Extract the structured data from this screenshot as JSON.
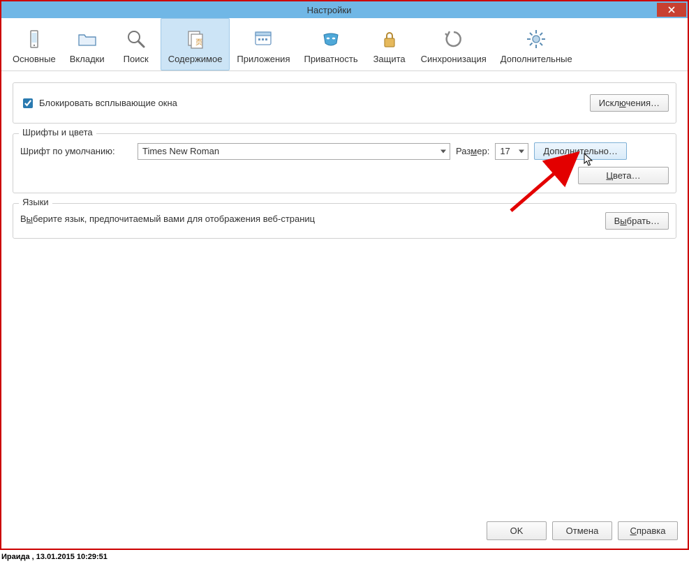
{
  "window": {
    "title": "Настройки"
  },
  "toolbar": {
    "items": [
      {
        "label": "Основные"
      },
      {
        "label": "Вкладки"
      },
      {
        "label": "Поиск"
      },
      {
        "label": "Содержимое"
      },
      {
        "label": "Приложения"
      },
      {
        "label": "Приватность"
      },
      {
        "label": "Защита"
      },
      {
        "label": "Синхронизация"
      },
      {
        "label": "Дополнительные"
      }
    ],
    "activeIndex": 3
  },
  "popup": {
    "checkbox_label": "Блокировать всплывающие окна",
    "checked": true,
    "exceptions_btn": "Исключения…",
    "exceptions_u": "ю"
  },
  "fonts": {
    "legend": "Шрифты и цвета",
    "default_font_label": "Шрифт по умолчанию:",
    "default_font_value": "Times New Roman",
    "size_label": "Размер:",
    "size_u": "м",
    "size_value": "17",
    "advanced_btn": "Дополнительно…",
    "advanced_u": "н",
    "colors_btn": "Цвета…",
    "colors_u": "Ц"
  },
  "languages": {
    "legend": "Языки",
    "text": "Выберите язык, предпочитаемый вами для отображения веб-страниц",
    "text_u": "ы",
    "choose_btn": "Выбрать…",
    "choose_u": "ы"
  },
  "buttons": {
    "ok": "OK",
    "cancel": "Отмена",
    "help": "Справка",
    "help_u": "С"
  },
  "footer": "Ираида  ,  13.01.2015 10:29:51"
}
